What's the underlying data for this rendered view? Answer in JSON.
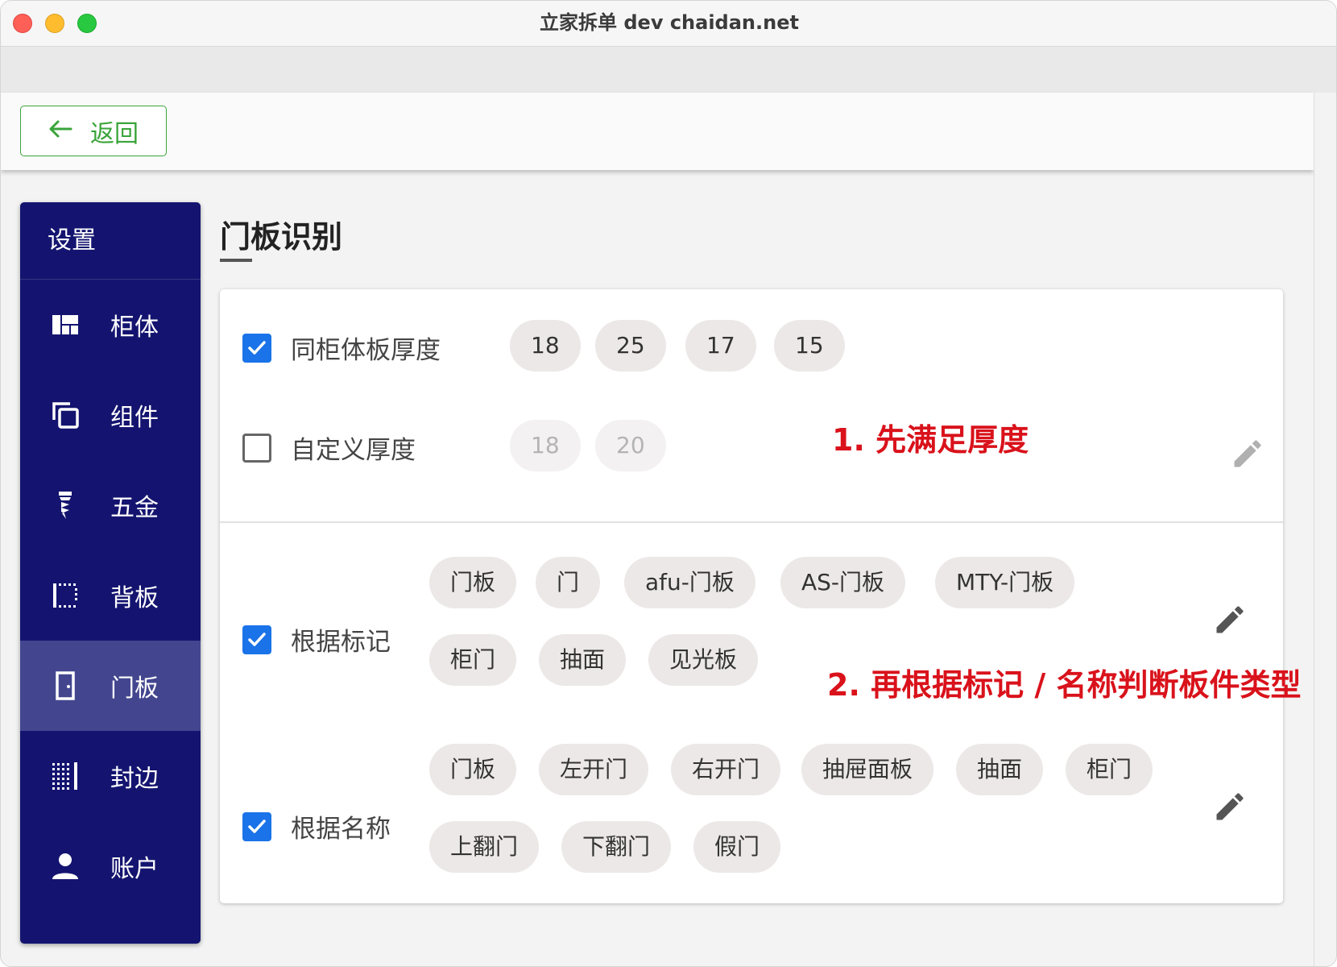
{
  "window": {
    "title": "立家拆单 dev  chaidan.net"
  },
  "appbar": {
    "back_label": "返回"
  },
  "sidebar": {
    "header": "设置",
    "items": [
      {
        "label": "柜体",
        "icon": "dashboard-icon"
      },
      {
        "label": "组件",
        "icon": "copy-icon"
      },
      {
        "label": "五金",
        "icon": "drill-icon"
      },
      {
        "label": "背板",
        "icon": "dotted-frame-icon"
      },
      {
        "label": "门板",
        "icon": "door-icon",
        "active": true
      },
      {
        "label": "封边",
        "icon": "grid-dots-icon"
      },
      {
        "label": "账户",
        "icon": "person-icon"
      }
    ]
  },
  "main": {
    "title": "门板识别",
    "thickness_section": {
      "same_thickness": {
        "label": "同柜体板厚度",
        "checked": true,
        "values": [
          "18",
          "25",
          "17",
          "15"
        ]
      },
      "custom_thickness": {
        "label": "自定义厚度",
        "checked": false,
        "values": [
          "18",
          "20"
        ]
      }
    },
    "by_mark": {
      "label": "根据标记",
      "checked": true,
      "tags": [
        "门板",
        "门",
        "afu-门板",
        "AS-门板",
        "MTY-门板",
        "柜门",
        "抽面",
        "见光板"
      ]
    },
    "by_name": {
      "label": "根据名称",
      "checked": true,
      "tags": [
        "门板",
        "左开门",
        "右开门",
        "抽屉面板",
        "抽面",
        "柜门",
        "上翻门",
        "下翻门",
        "假门"
      ]
    }
  },
  "annotations": {
    "step1": "1. 先满足厚度",
    "step2": "2. 再根据标记 / 名称判断板件类型",
    "color": "#d9121b"
  },
  "colors": {
    "sidebar_bg": "#141470",
    "sidebar_active": "#43468f",
    "accent_green": "#3aa43a",
    "checkbox_blue": "#1a73e8",
    "chip_bg": "#ece8e7"
  }
}
